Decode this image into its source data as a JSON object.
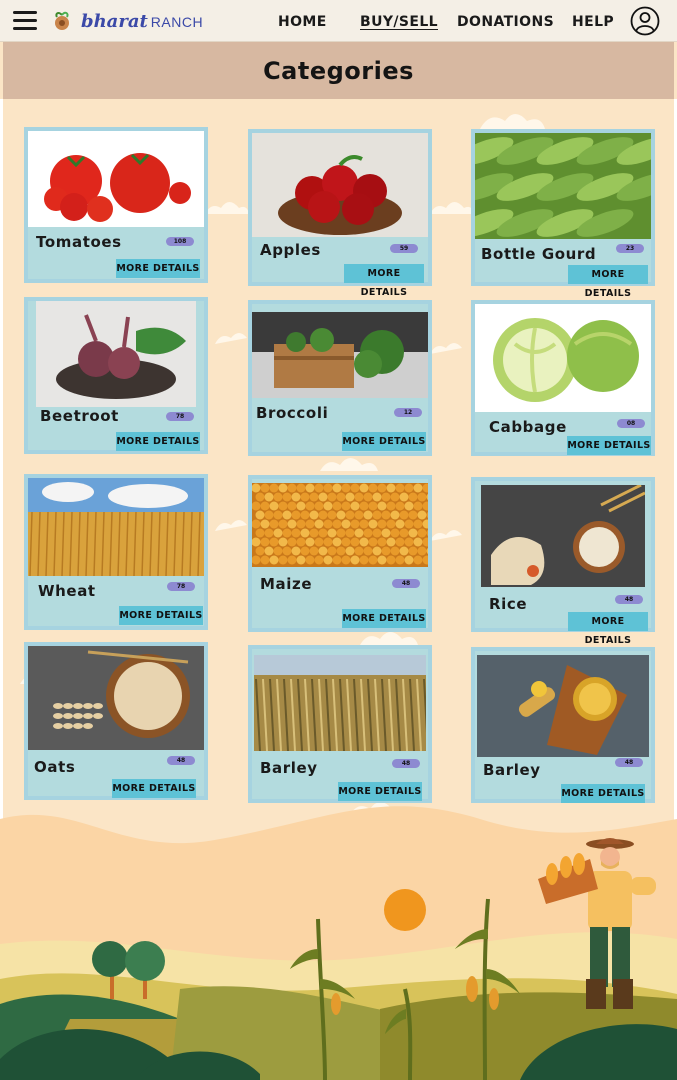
{
  "nav": {
    "logo_bharat": "bharat",
    "logo_ranch": "RANCH",
    "links": [
      "HOME",
      "BUY/SELL",
      "DONATIONS",
      "HELP"
    ]
  },
  "page_title": "Categories",
  "categories": [
    {
      "name": "Tomatoes",
      "count": "108",
      "action": "MORE DETAILS",
      "image": "tomatoes-image"
    },
    {
      "name": "Apples",
      "count": "59",
      "action": "MORE DETAILS",
      "image": "apples-image"
    },
    {
      "name": "Bottle Gourd",
      "count": "23",
      "action": "MORE DETAILS",
      "image": "bottle-gourd-image"
    },
    {
      "name": "Beetroot",
      "count": "78",
      "action": "MORE DETAILS",
      "image": "beetroot-image"
    },
    {
      "name": "Broccoli",
      "count": "12",
      "action": "MORE DETAILS",
      "image": "broccoli-image"
    },
    {
      "name": "Cabbage",
      "count": "08",
      "action": "MORE DETAILS",
      "image": "cabbage-image"
    },
    {
      "name": "Wheat",
      "count": "78",
      "action": "MORE DETAILS",
      "image": "wheat-image"
    },
    {
      "name": "Maize",
      "count": "48",
      "action": "MORE DETAILS",
      "image": "maize-image"
    },
    {
      "name": "Rice",
      "count": "48",
      "action": "MORE DETAILS",
      "image": "rice-image"
    },
    {
      "name": "Oats",
      "count": "48",
      "action": "MORE DETAILS",
      "image": "oats-image"
    },
    {
      "name": "Barley",
      "count": "48",
      "action": "MORE DETAILS",
      "image": "barley-field-image"
    },
    {
      "name": "Barley",
      "count": "48",
      "action": "MORE DETAILS",
      "image": "barley-grain-image"
    }
  ],
  "colors": {
    "background": "#fbe5c6",
    "navbar": "#f4efe6",
    "header_band": "#d7b8a1",
    "card": "#b3dbde",
    "card_border": "#a6d3e0",
    "button": "#5ec2d6",
    "badge": "#8d8ad1",
    "sun": "#f0961e"
  }
}
